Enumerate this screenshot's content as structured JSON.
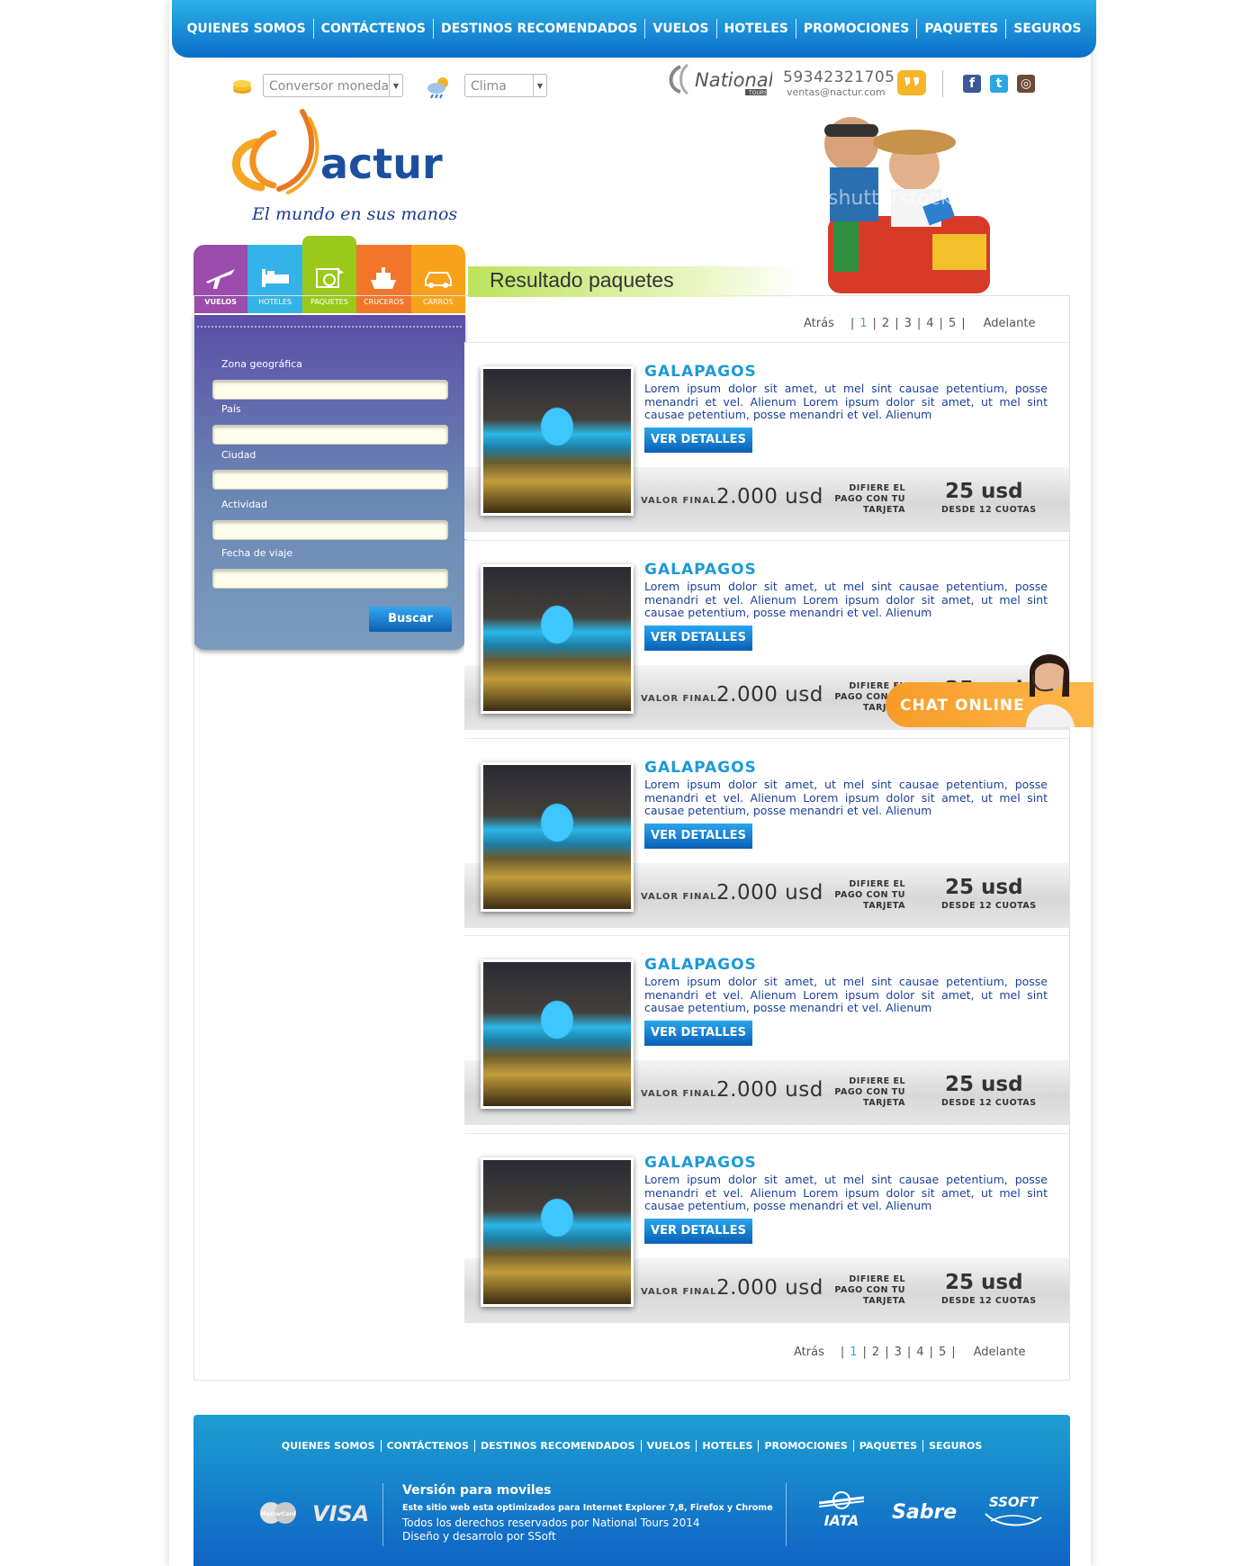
{
  "nav": [
    "QUIENES SOMOS",
    "CONTÁCTENOS",
    "DESTINOS RECOMENDADOS",
    "VUELOS",
    "HOTELES",
    "PROMOCIONES",
    "PAQUETES",
    "SEGUROS"
  ],
  "utility": {
    "currency_placeholder": "Conversor moneda",
    "weather_placeholder": "Clima",
    "phone": "59342321705",
    "email": "ventas@nactur.com",
    "partner": "National",
    "partner_sub": "TOURS"
  },
  "brand": {
    "name": "actur",
    "slogan": "El mundo en sus manos",
    "watermark": "shutterstock"
  },
  "search": {
    "tabs": [
      {
        "label": "VUELOS",
        "color": "#9b4cac",
        "icon": "plane-icon"
      },
      {
        "label": "HOTELES",
        "color": "#34b3e8",
        "icon": "bed-icon"
      },
      {
        "label": "PAQUETES",
        "color": "#9ac81b",
        "icon": "package-icon"
      },
      {
        "label": "CRUCEROS",
        "color": "#f2762a",
        "icon": "ship-icon"
      },
      {
        "label": "CARROS",
        "color": "#f8a21c",
        "icon": "car-icon"
      }
    ],
    "fields": [
      "Zona geográfica",
      "País",
      "Ciudad",
      "Actividad",
      "Fecha de viaje"
    ],
    "button": "Buscar"
  },
  "results": {
    "title": "Resultado paquetes",
    "pager": {
      "prev": "Atrás",
      "next": "Adelante",
      "pages": [
        "1",
        "2",
        "3",
        "4",
        "5"
      ],
      "current": "1"
    },
    "cards": [
      {
        "title": "GALAPAGOS",
        "desc": "Lorem ipsum dolor sit amet, ut mel sint causae petentium, posse menandri et vel. Alienum Lorem ipsum dolor sit amet, ut mel sint causae petentium, posse menandri et vel. Alienum"
      },
      {
        "title": "GALAPAGOS",
        "desc": "Lorem ipsum dolor sit amet, ut mel sint causae petentium, posse menandri et vel. Alienum Lorem ipsum dolor sit amet, ut mel sint causae petentium, posse menandri et vel. Alienum"
      },
      {
        "title": "GALAPAGOS",
        "desc": "Lorem ipsum dolor sit amet, ut mel sint causae petentium, posse menandri et vel. Alienum Lorem ipsum dolor sit amet, ut mel sint causae petentium, posse menandri et vel. Alienum"
      },
      {
        "title": "GALAPAGOS",
        "desc": "Lorem ipsum dolor sit amet, ut mel sint causae petentium, posse menandri et vel. Alienum Lorem ipsum dolor sit amet, ut mel sint causae petentium, posse menandri et vel. Alienum"
      },
      {
        "title": "GALAPAGOS",
        "desc": "Lorem ipsum dolor sit amet, ut mel sint causae petentium, posse menandri et vel. Alienum Lorem ipsum dolor sit amet, ut mel sint causae petentium, posse menandri et vel. Alienum"
      }
    ],
    "details_label": "VER DETALLES",
    "final_label": "VALOR FINAL",
    "price": "2.000 usd",
    "defer_label": [
      "DIFIERE EL",
      "PAGO CON TU",
      "TARJETA"
    ],
    "installment": "25 usd",
    "installment_note": "DESDE 12 CUOTAS"
  },
  "chat": {
    "label": "CHAT ONLINE"
  },
  "footer": {
    "nav": [
      "QUIENES SOMOS",
      "CONTÁCTENOS",
      "DESTINOS RECOMENDADOS",
      "VUELOS",
      "HOTELES",
      "PROMOCIONES",
      "PAQUETES",
      "SEGUROS"
    ],
    "mobile": "Versión para moviles",
    "optimized": "Este sitio web esta optimizados para Internet Explorer 7,8, Firefox y Chrome",
    "rights": "Todos los derechos reservados por National Tours 2014",
    "design": "Diseño y desarrolo por SSoft",
    "cards": [
      "MasterCard",
      "VISA"
    ],
    "partners": [
      "IATA",
      "Sabre",
      "SSOFT"
    ]
  }
}
